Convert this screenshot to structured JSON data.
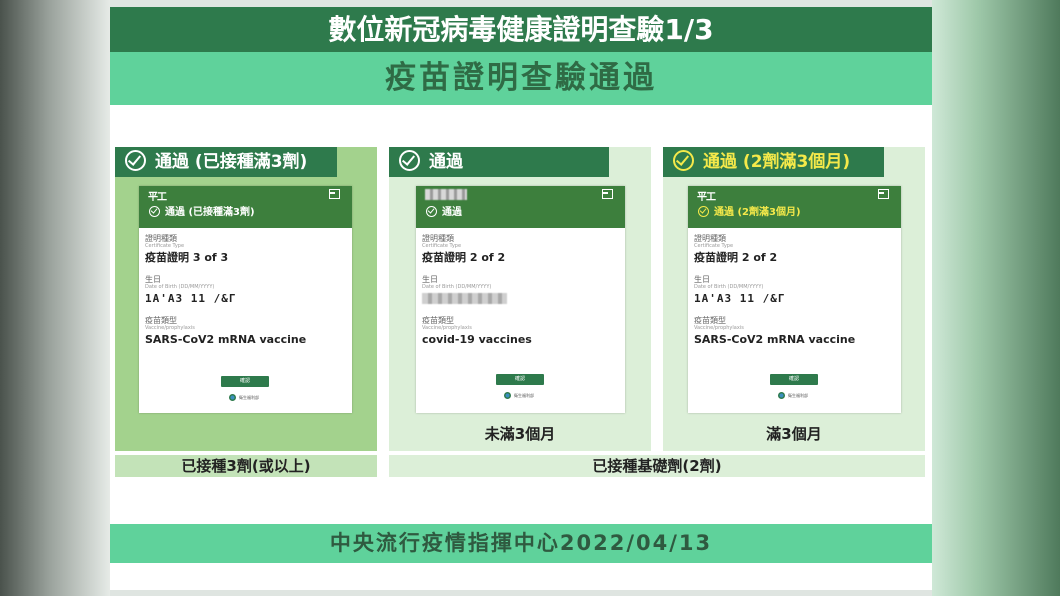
{
  "slide": {
    "title": "數位新冠病毒健康證明查驗1/3",
    "subtitle": "疫苗證明查驗通過",
    "footer": "中央流行疫情指揮中心2022/04/13"
  },
  "columns": [
    {
      "label": "通過 (已接種滿3劑)",
      "card": {
        "name": "平工",
        "status": "通過 (已接種滿3劑)",
        "cert_type_label": "證明種類",
        "cert_type_sub": "Certificate Type",
        "cert_type_value": "疫苗證明 3 of 3",
        "dob_label": "生日",
        "dob_sub": "Date of Birth (DD/MM/YYYY)",
        "dob_value": "1A'AЗ 11 /&Γ",
        "vaccine_label": "疫苗類型",
        "vaccine_sub": "Vaccine/prophylaxis",
        "vaccine_value": "SARS-CoV2 mRNA vaccine",
        "confirm": "確認",
        "logo": "衛生福利部"
      },
      "caption": ""
    },
    {
      "label": "通過",
      "card": {
        "name": "",
        "status": "通過",
        "cert_type_label": "證明種類",
        "cert_type_sub": "Certificate Type",
        "cert_type_value": "疫苗證明 2 of 2",
        "dob_label": "生日",
        "dob_sub": "Date of Birth (DD/MM/YYYY)",
        "dob_value": "",
        "vaccine_label": "疫苗類型",
        "vaccine_sub": "Vaccine/prophylaxis",
        "vaccine_value": "covid-19 vaccines",
        "confirm": "確認",
        "logo": "衛生福利部"
      },
      "caption": "未滿3個月"
    },
    {
      "label": "通過 (2劑滿3個月)",
      "card": {
        "name": "平工",
        "status": "通過 (2劑滿3個月)",
        "cert_type_label": "證明種類",
        "cert_type_sub": "Certificate Type",
        "cert_type_value": "疫苗證明 2 of 2",
        "dob_label": "生日",
        "dob_sub": "Date of Birth (DD/MM/YYYY)",
        "dob_value": "1A'AЗ 11 /&Γ",
        "vaccine_label": "疫苗類型",
        "vaccine_sub": "Vaccine/prophylaxis",
        "vaccine_value": "SARS-CoV2 mRNA vaccine",
        "confirm": "確認",
        "logo": "衛生福利部"
      },
      "caption": "滿3個月"
    }
  ],
  "bottom_labels": {
    "left": "已接種3劑(或以上)",
    "right": "已接種基礎劑(2劑)"
  },
  "colors": {
    "dark_green": "#2e7a4c",
    "mint": "#5fd29b",
    "highlight_yellow": "#f5e94a",
    "panel_green": "#a3d28d",
    "panel_light": "#dcefd8"
  }
}
